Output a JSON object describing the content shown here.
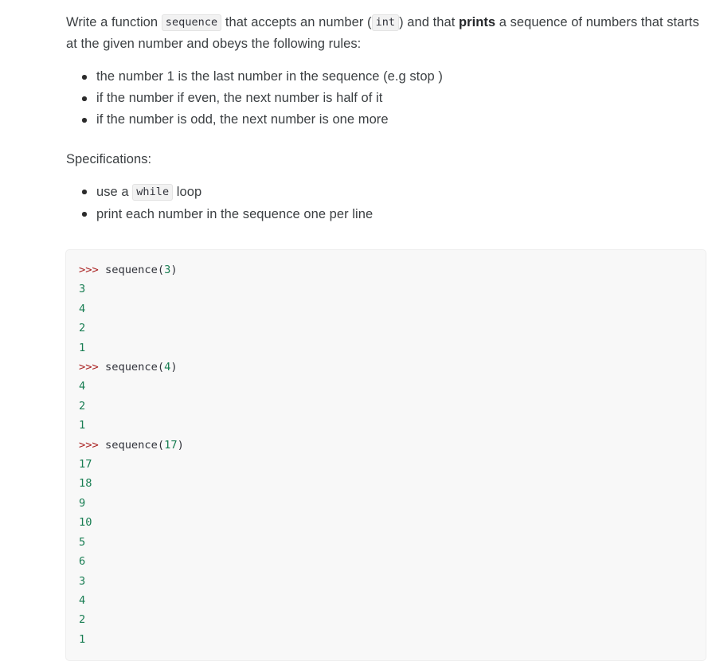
{
  "exercise": {
    "intro": {
      "part1": "Write a function ",
      "code_sequence": "sequence",
      "part2": " that accepts an number (",
      "code_int": "int",
      "part3": ") and that ",
      "bold_prints": "prints",
      "part4": " a sequence of numbers that starts at the given number and obeys the following rules:"
    },
    "rules": [
      "the number 1 is the last number in the sequence (e.g stop )",
      "if the number if even, the next number is half of it",
      "if the number is odd, the next number is one more"
    ],
    "specifications_label": "Specifications:",
    "specifications": [
      {
        "pre": "use a ",
        "code": "while",
        "post": " loop"
      },
      {
        "pre": "print each number in the sequence one per line",
        "code": "",
        "post": ""
      }
    ],
    "console": {
      "prompt": ">>> ",
      "lines": [
        {
          "type": "input",
          "call": "sequence",
          "open": "(",
          "arg": "3",
          "close": ")"
        },
        {
          "type": "output",
          "value": "3"
        },
        {
          "type": "output",
          "value": "4"
        },
        {
          "type": "output",
          "value": "2"
        },
        {
          "type": "output",
          "value": "1"
        },
        {
          "type": "input",
          "call": "sequence",
          "open": "(",
          "arg": "4",
          "close": ")"
        },
        {
          "type": "output",
          "value": "4"
        },
        {
          "type": "output",
          "value": "2"
        },
        {
          "type": "output",
          "value": "1"
        },
        {
          "type": "input",
          "call": "sequence",
          "open": "(",
          "arg": "17",
          "close": ")"
        },
        {
          "type": "output",
          "value": "17"
        },
        {
          "type": "output",
          "value": "18"
        },
        {
          "type": "output",
          "value": "9"
        },
        {
          "type": "output",
          "value": "10"
        },
        {
          "type": "output",
          "value": "5"
        },
        {
          "type": "output",
          "value": "6"
        },
        {
          "type": "output",
          "value": "3"
        },
        {
          "type": "output",
          "value": "4"
        },
        {
          "type": "output",
          "value": "2"
        },
        {
          "type": "output",
          "value": "1"
        }
      ]
    },
    "colors": {
      "prompt": "#aa2222",
      "number": "#177d52",
      "text": "#3c4043",
      "code_background": "#f8f8f8",
      "chip_background": "#f2f2f2"
    }
  }
}
